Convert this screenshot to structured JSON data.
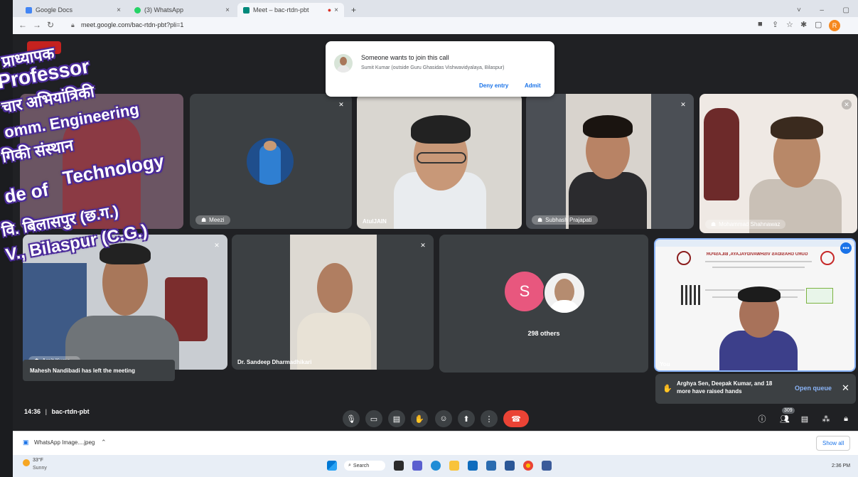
{
  "browser": {
    "tabs": [
      {
        "label": "Google Docs",
        "color": "#4285f4"
      },
      {
        "label": "(3) WhatsApp",
        "color": "#25d366"
      },
      {
        "label": "Meet – bac-rtdn-pbt",
        "color": "#00897b"
      }
    ],
    "url": "meet.google.com/bac-rtdn-pbt?pli=1",
    "profile_initial": "R"
  },
  "join_request": {
    "title": "Someone wants to join this call",
    "detail": "Sumit Kumar (outside Guru Ghasidas Vishwavidyalaya, Bilaspur)",
    "deny_label": "Deny entry",
    "admit_label": "Admit"
  },
  "participants": {
    "p1": "",
    "p2": "Meezi",
    "p3": "AtulJAIN",
    "p4": "Subhash Prajapati",
    "p5": "Mohammad Shahnawaz",
    "p6": "Arpit Kuma...",
    "p7": "Dr. Sandeep Dharmadhikari",
    "others_initial": "S",
    "others_label": "298 others",
    "presenter_label": "You"
  },
  "presentation": {
    "heading": "GURU GHASIDAS VISHWAVIDYALAYA, BILASPUR"
  },
  "notices": {
    "left_meeting": "Mahesh Nandibadi has left the meeting",
    "raised_hands": "Arghya Sen, Deepak Kumar, and 18 more have raised hands",
    "open_queue": "Open queue"
  },
  "meeting": {
    "time": "14:36",
    "code": "bac-rtdn-pbt",
    "people_count": "309"
  },
  "downloads": {
    "file": "WhatsApp Image....jpeg",
    "show_all": "Show all"
  },
  "taskbar": {
    "weather_temp": "33°F",
    "weather_text": "Sunny",
    "search_label": "Search",
    "clock": "2:36 PM"
  },
  "stamp": {
    "line1": "प्राध्यापक",
    "line2": "Professor",
    "line3": "चार अभियांत्रिकी",
    "line4": "omm. Engineering",
    "line5": "गिकी संस्थान",
    "line6": "Technology",
    "line7": "de of",
    "line8": "वि. बिलासपुर (छ.ग.)",
    "line9": "V., Bilaspur (C.G.)"
  },
  "colors": {
    "meet_bg": "#202124",
    "tile_bg": "#3c4043",
    "end_call": "#ea4335",
    "accent": "#1a73e8",
    "stamp_ink": "#4a2a9a"
  }
}
